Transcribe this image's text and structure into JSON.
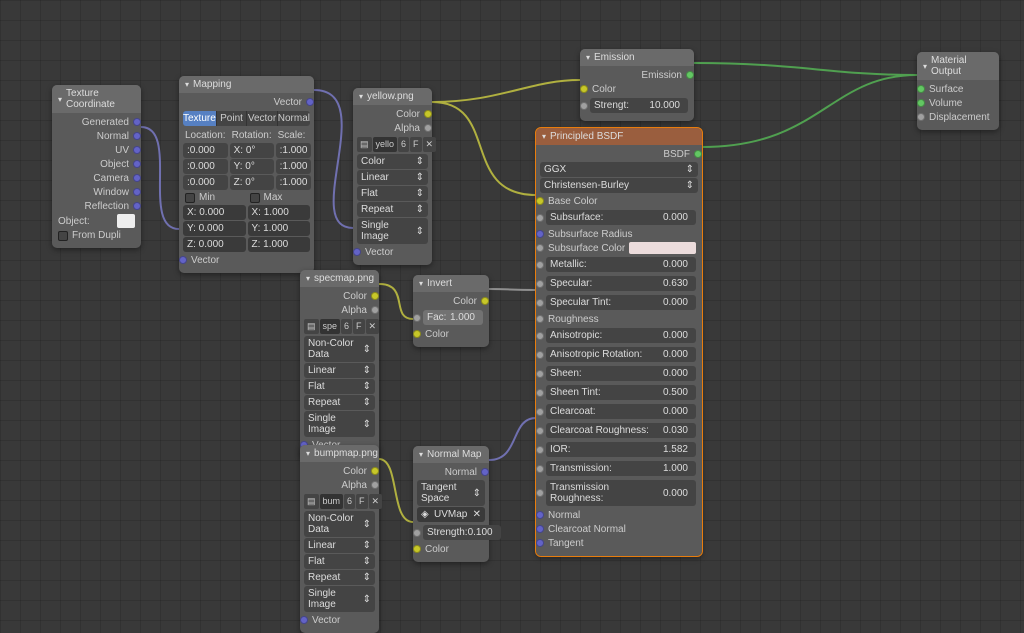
{
  "texcoord": {
    "title": "Texture Coordinate",
    "outs": [
      "Generated",
      "Normal",
      "UV",
      "Object",
      "Camera",
      "Window",
      "Reflection"
    ],
    "object_label": "Object:",
    "from_dupli": "From Dupli"
  },
  "mapping": {
    "title": "Mapping",
    "out": "Vector",
    "tabs": [
      "Texture",
      "Point",
      "Vector",
      "Normal"
    ],
    "loc_label": "Location:",
    "rot_label": "Rotation:",
    "scale_label": "Scale:",
    "loc": {
      "x": ":0.000",
      "y": ":0.000",
      "z": ":0.000"
    },
    "rot": {
      "x": "X: 0°",
      "y": "Y: 0°",
      "z": "Z: 0°"
    },
    "scale": {
      "x": ":1.000",
      "y": ":1.000",
      "z": ":1.000"
    },
    "min_label": "Min",
    "max_label": "Max",
    "min": {
      "x": "X: 0.000",
      "y": "Y: 0.000",
      "z": "Z: 0.000"
    },
    "max": {
      "x": "X: 1.000",
      "y": "Y: 1.000",
      "z": "Z: 1.000"
    },
    "in": "Vector"
  },
  "img_yellow": {
    "title": "yellow.png",
    "out_color": "Color",
    "out_alpha": "Alpha",
    "file": "yello",
    "btns": [
      "6",
      "F",
      "✕"
    ],
    "color_space": "Color",
    "interp": "Linear",
    "proj": "Flat",
    "ext": "Repeat",
    "source": "Single Image",
    "in": "Vector"
  },
  "img_spec": {
    "title": "specmap.png",
    "out_color": "Color",
    "out_alpha": "Alpha",
    "file": "spe",
    "btns": [
      "6",
      "F",
      "✕"
    ],
    "color_space": "Non-Color Data",
    "interp": "Linear",
    "proj": "Flat",
    "ext": "Repeat",
    "source": "Single Image",
    "in": "Vector"
  },
  "img_bump": {
    "title": "bumpmap.png",
    "out_color": "Color",
    "out_alpha": "Alpha",
    "file": "bum",
    "btns": [
      "6",
      "F",
      "✕"
    ],
    "color_space": "Non-Color Data",
    "interp": "Linear",
    "proj": "Flat",
    "ext": "Repeat",
    "source": "Single Image",
    "in": "Vector"
  },
  "invert": {
    "title": "Invert",
    "out": "Color",
    "fac_label": "Fac:",
    "fac": "1.000",
    "in": "Color"
  },
  "normalmap": {
    "title": "Normal Map",
    "out": "Normal",
    "space": "Tangent Space",
    "uvmap": "UVMap",
    "strength_label": "Strength:",
    "strength": "0.100",
    "in": "Color"
  },
  "emission": {
    "title": "Emission",
    "out": "Emission",
    "color": "Color",
    "strength_label": "Strengt:",
    "strength": "10.000"
  },
  "principled": {
    "title": "Principled BSDF",
    "out": "BSDF",
    "dist": "GGX",
    "sss": "Christensen-Burley",
    "props": [
      {
        "name": "Base Color",
        "type": "socket-color"
      },
      {
        "name": "Subsurface:",
        "val": "0.000"
      },
      {
        "name": "Subsurface Radius",
        "type": "socket-vec"
      },
      {
        "name": "Subsurface Color",
        "type": "swatch-sss"
      },
      {
        "name": "Metallic:",
        "val": "0.000"
      },
      {
        "name": "Specular:",
        "val": "0.630"
      },
      {
        "name": "Specular Tint:",
        "val": "0.000"
      },
      {
        "name": "Roughness",
        "type": "socket-fac"
      },
      {
        "name": "Anisotropic:",
        "val": "0.000"
      },
      {
        "name": "Anisotropic Rotation:",
        "val": "0.000"
      },
      {
        "name": "Sheen:",
        "val": "0.000"
      },
      {
        "name": "Sheen Tint:",
        "val": "0.500"
      },
      {
        "name": "Clearcoat:",
        "val": "0.000"
      },
      {
        "name": "Clearcoat Roughness:",
        "val": "0.030"
      },
      {
        "name": "IOR:",
        "val": "1.582"
      },
      {
        "name": "Transmission:",
        "val": "1.000"
      },
      {
        "name": "Transmission Roughness:",
        "val": "0.000"
      },
      {
        "name": "Normal",
        "type": "socket-vec"
      },
      {
        "name": "Clearcoat Normal",
        "type": "socket-vec"
      },
      {
        "name": "Tangent",
        "type": "socket-vec"
      }
    ]
  },
  "matout": {
    "title": "Material Output",
    "surface": "Surface",
    "volume": "Volume",
    "disp": "Displacement"
  }
}
